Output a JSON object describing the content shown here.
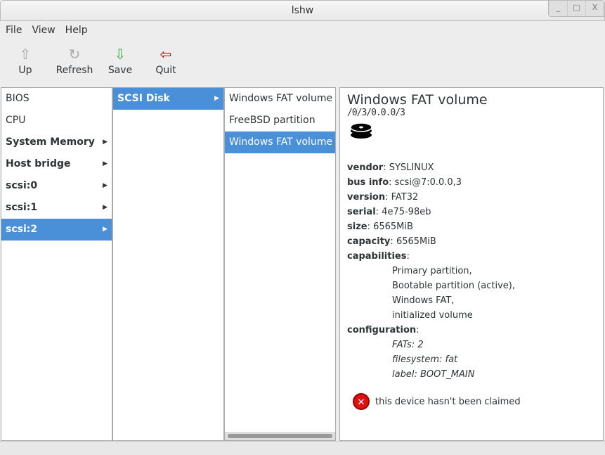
{
  "window": {
    "title": "lshw"
  },
  "menu": [
    "File",
    "View",
    "Help"
  ],
  "toolbar": [
    {
      "label": "Up",
      "icon": "up-icon"
    },
    {
      "label": "Refresh",
      "icon": "refresh-icon"
    },
    {
      "label": "Save",
      "icon": "save-icon"
    },
    {
      "label": "Quit",
      "icon": "quit-icon"
    }
  ],
  "col1": [
    "BIOS",
    "CPU",
    "System Memory",
    "Host bridge",
    "scsi:0",
    "scsi:1",
    "scsi:2"
  ],
  "col2": [
    "SCSI Disk"
  ],
  "col3": [
    "Windows FAT volume",
    "FreeBSD partition",
    "Windows FAT volume"
  ],
  "detail": {
    "title": "Windows FAT volume",
    "path": "/0/3/0.0.0/3",
    "fields": [
      [
        "vendor",
        "SYSLINUX"
      ],
      [
        "bus info",
        "scsi@7:0.0.0,3"
      ],
      [
        "version",
        "FAT32"
      ],
      [
        "serial",
        "4e75-98eb"
      ],
      [
        "size",
        "6565MiB"
      ],
      [
        "capacity",
        "6565MiB"
      ]
    ],
    "capabilities_label": "capabilities",
    "capabilities": [
      "Primary partition,",
      "Bootable partition (active),",
      "Windows FAT,",
      "initialized volume"
    ],
    "configuration_label": "configuration",
    "configuration": [
      "FATs: 2",
      "filesystem: fat",
      "label: BOOT_MAIN"
    ],
    "warning": "this device hasn't been claimed"
  }
}
